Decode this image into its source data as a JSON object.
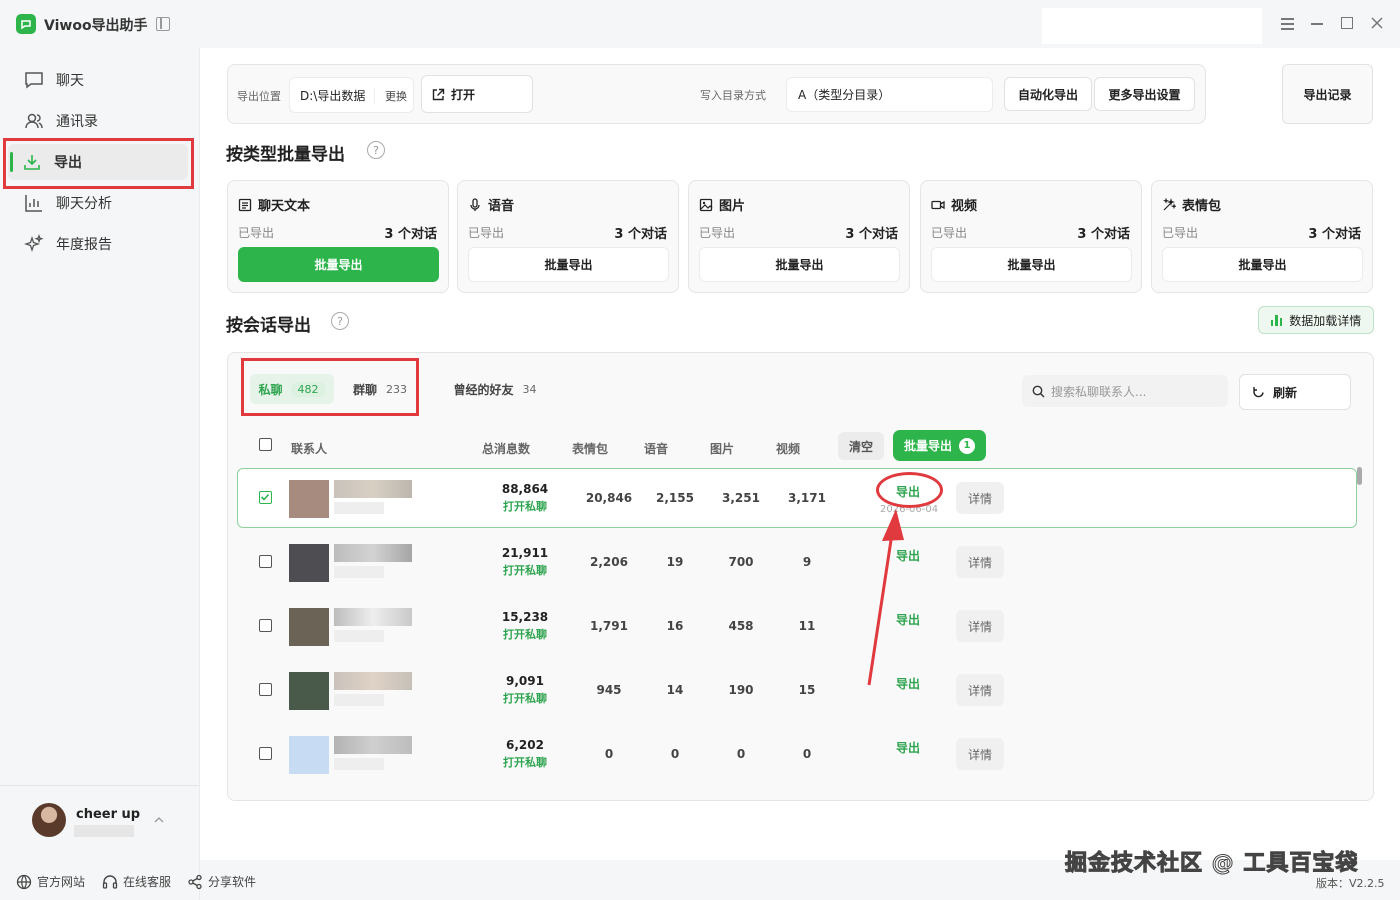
{
  "app": {
    "title": "Viwoo导出助手"
  },
  "sidebar": {
    "items": [
      {
        "label": "聊天",
        "icon": "chat-icon"
      },
      {
        "label": "通讯录",
        "icon": "contacts-icon"
      },
      {
        "label": "导出",
        "icon": "download-icon",
        "active": true
      },
      {
        "label": "聊天分析",
        "icon": "bar-chart-icon"
      },
      {
        "label": "年度报告",
        "icon": "sparkle-icon"
      }
    ],
    "user": {
      "name": "cheer up"
    },
    "footer": [
      {
        "label": "官方网站",
        "icon": "globe-icon"
      },
      {
        "label": "在线客服",
        "icon": "headset-icon"
      },
      {
        "label": "分享软件",
        "icon": "share-icon"
      }
    ]
  },
  "toolbar": {
    "path_label": "导出位置",
    "path_value": "D:\\导出数据",
    "change_label": "更换",
    "open_label": "打开",
    "dir_mode_label": "写入目录方式",
    "dir_mode_value": "A（类型分目录）",
    "auto_export": "自动化导出",
    "more_settings": "更多导出设置",
    "export_records": "导出记录"
  },
  "batch": {
    "title": "按类型批量导出",
    "cards": [
      {
        "title": "聊天文本",
        "icon": "text-doc-icon",
        "exported_label": "已导出",
        "count": "3 个对话",
        "button": "批量导出",
        "primary": true
      },
      {
        "title": "语音",
        "icon": "mic-icon",
        "exported_label": "已导出",
        "count": "3 个对话",
        "button": "批量导出"
      },
      {
        "title": "图片",
        "icon": "image-icon",
        "exported_label": "已导出",
        "count": "3 个对话",
        "button": "批量导出"
      },
      {
        "title": "视频",
        "icon": "video-icon",
        "exported_label": "已导出",
        "count": "3 个对话",
        "button": "批量导出"
      },
      {
        "title": "表情包",
        "icon": "magic-wand-icon",
        "exported_label": "已导出",
        "count": "3 个对话",
        "button": "批量导出"
      }
    ]
  },
  "session": {
    "title": "按会话导出",
    "data_detail": "数据加载详情",
    "tabs": [
      {
        "label": "私聊",
        "count": "482",
        "active": true
      },
      {
        "label": "群聊",
        "count": "233"
      },
      {
        "label": "曾经的好友",
        "count": "34"
      }
    ],
    "search_placeholder": "搜索私聊联系人...",
    "refresh": "刷新",
    "columns": {
      "contact": "联系人",
      "total": "总消息数",
      "sticker": "表情包",
      "voice": "语音",
      "image": "图片",
      "video": "视频"
    },
    "clear": "清空",
    "batch_export": "批量导出",
    "batch_count": "1",
    "rows": [
      {
        "total": "88,864",
        "open": "打开私聊",
        "sticker": "20,846",
        "voice": "2,155",
        "image": "3,251",
        "video": "3,171",
        "export": "导出",
        "date": "2026-06-04",
        "detail": "详情",
        "checked": true
      },
      {
        "total": "21,911",
        "open": "打开私聊",
        "sticker": "2,206",
        "voice": "19",
        "image": "700",
        "video": "9",
        "export": "导出",
        "detail": "详情"
      },
      {
        "total": "15,238",
        "open": "打开私聊",
        "sticker": "1,791",
        "voice": "16",
        "image": "458",
        "video": "11",
        "export": "导出",
        "detail": "详情"
      },
      {
        "total": "9,091",
        "open": "打开私聊",
        "sticker": "945",
        "voice": "14",
        "image": "190",
        "video": "15",
        "export": "导出",
        "detail": "详情"
      },
      {
        "total": "6,202",
        "open": "打开私聊",
        "sticker": "0",
        "voice": "0",
        "image": "0",
        "video": "0",
        "export": "导出",
        "detail": "详情"
      }
    ]
  },
  "watermark": "掘金技术社区 @ 工具百宝袋",
  "version": "版本：V2.2.5",
  "colors": {
    "accent": "#2db54b",
    "highlight": "#e0393e"
  }
}
